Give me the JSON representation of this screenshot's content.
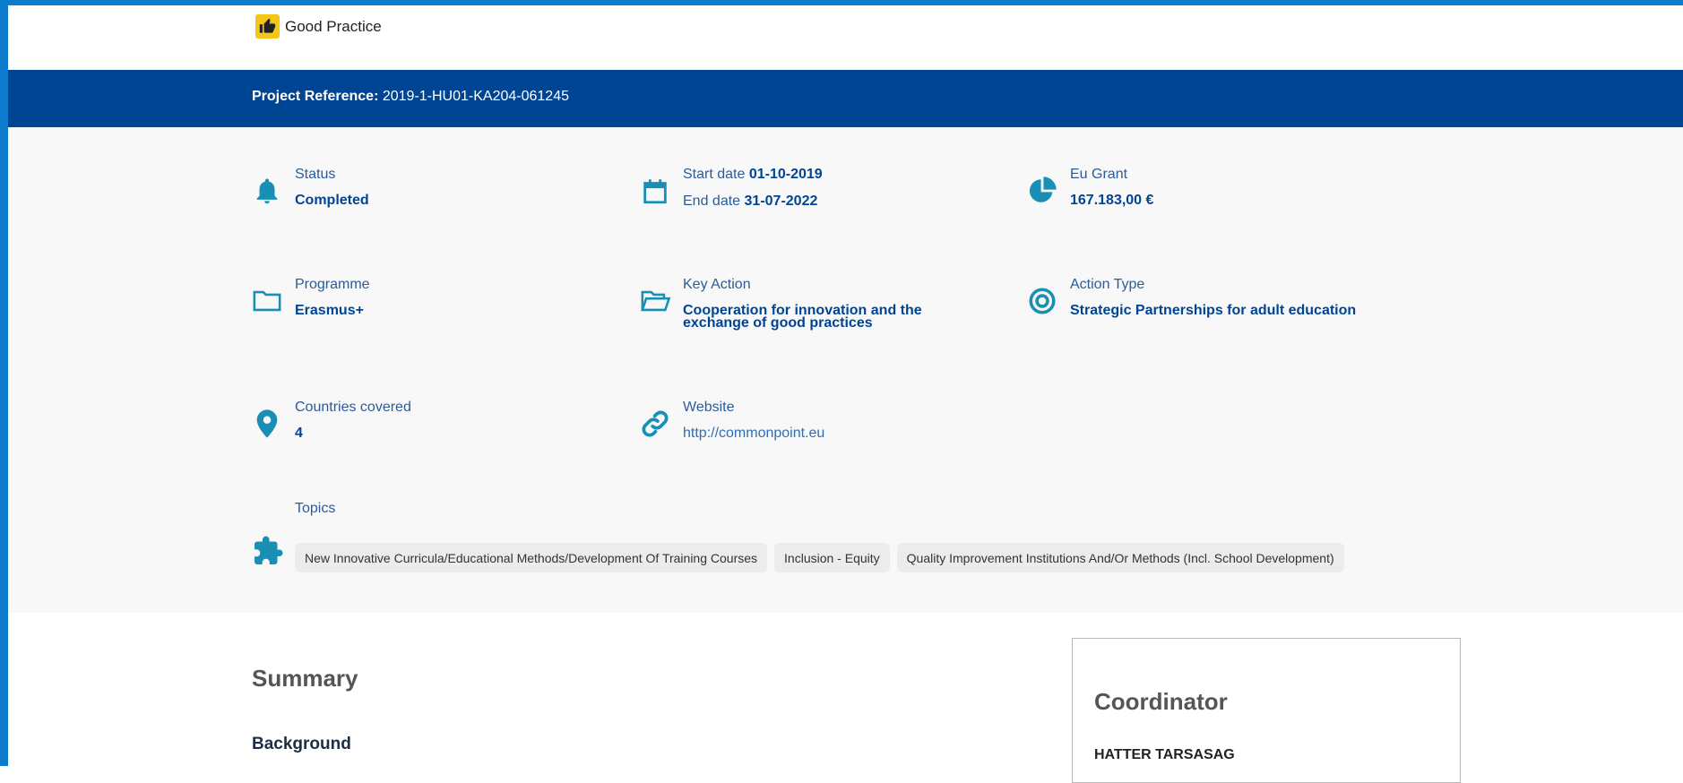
{
  "badge": {
    "label": "Good Practice",
    "icon": "thumbs-up-icon"
  },
  "reference": {
    "label": "Project Reference:",
    "value": "2019-1-HU01-KA204-061245"
  },
  "status": {
    "label": "Status",
    "value": "Completed",
    "icon": "bell-icon"
  },
  "dates": {
    "start_label": "Start date",
    "start_value": "01-10-2019",
    "end_label": "End date",
    "end_value": "31-07-2022",
    "icon": "calendar-icon"
  },
  "grant": {
    "label": "Eu Grant",
    "value": "167.183,00 €",
    "icon": "pie-chart-icon"
  },
  "programme": {
    "label": "Programme",
    "value": "Erasmus+",
    "icon": "folder-icon"
  },
  "key_action": {
    "label": "Key Action",
    "value_line1": "Cooperation for innovation and the",
    "value_line2": "exchange of good practices",
    "icon": "folder-open-icon"
  },
  "action_type": {
    "label": "Action Type",
    "value": "Strategic Partnerships for adult education",
    "icon": "target-icon"
  },
  "countries": {
    "label": "Countries covered",
    "value": "4",
    "icon": "map-pin-icon"
  },
  "website": {
    "label": "Website",
    "value": "http://commonpoint.eu",
    "icon": "link-icon"
  },
  "topics": {
    "label": "Topics",
    "icon": "puzzle-icon",
    "items": [
      "New Innovative Curricula/Educational Methods/Development Of Training Courses",
      "Inclusion - Equity",
      "Quality Improvement Institutions And/Or Methods (Incl. School Development)"
    ]
  },
  "summary": {
    "title": "Summary",
    "background_heading": "Background"
  },
  "coordinator": {
    "title": "Coordinator",
    "name": "HATTER TARSASAG"
  },
  "colors": {
    "primary": "#004494",
    "accent": "#1a8fb5",
    "frame": "#0d7ccc",
    "badge": "#f5c518"
  }
}
